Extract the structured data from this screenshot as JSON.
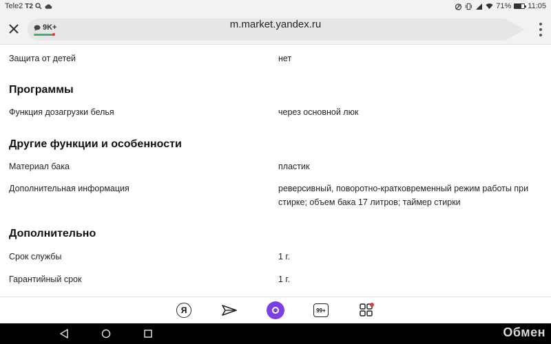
{
  "status_bar": {
    "carrier": "Tele2",
    "carrier_badge": "T2",
    "battery_percent": "71%",
    "time": "11:05",
    "battery_level": 0.71,
    "icons": [
      "search-icon",
      "cloud-icon",
      "alarm-icon",
      "vibrate-icon",
      "signal-icon",
      "wifi-icon"
    ]
  },
  "toolbar": {
    "url": "m.market.yandex.ru",
    "comments_count": "9K+",
    "accent_color": "#3cb371"
  },
  "specs": [
    {
      "type": "row",
      "label": "Защита от детей",
      "value": "нет"
    },
    {
      "type": "heading",
      "label": "Программы"
    },
    {
      "type": "row",
      "label": "Функция дозагрузки белья",
      "value": "через основной люк"
    },
    {
      "type": "heading",
      "label": "Другие функции и особенности"
    },
    {
      "type": "row",
      "label": "Материал бака",
      "value": "пластик"
    },
    {
      "type": "row",
      "label": "Дополнительная информация",
      "value": "реверсивный, поворотно-кратковременный режим работы при стирке; объем бака 17 литров; таймер стирки"
    },
    {
      "type": "heading",
      "label": "Дополнительно"
    },
    {
      "type": "row",
      "label": "Срок службы",
      "value": "1 г."
    },
    {
      "type": "row",
      "label": "Гарантийный срок",
      "value": "1 г."
    }
  ],
  "bottom_nav": {
    "yandex_label": "Я",
    "tabs_count": "99+",
    "alice_color": "#7b3fe4",
    "services_notification_color": "#e53935"
  },
  "watermark": "Обмен"
}
